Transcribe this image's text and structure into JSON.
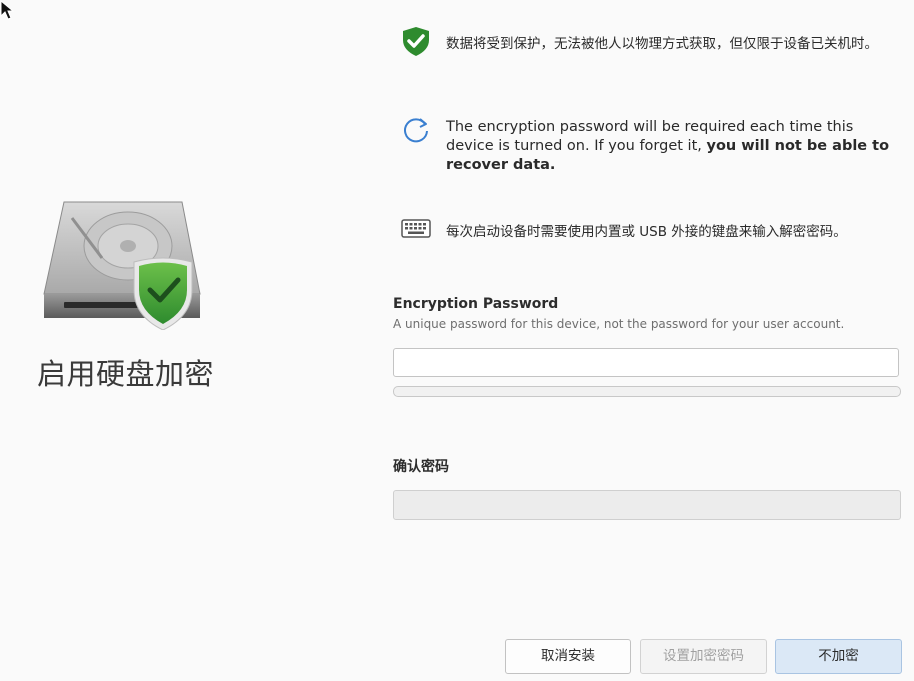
{
  "left": {
    "title": "启用硬盘加密"
  },
  "info": {
    "protect_text": "数据将受到保护，无法被他人以物理方式获取，但仅限于设备已关机时。",
    "password_text_plain": "The encryption password will be required each time this device is turned on. If you forget it, ",
    "password_text_bold": "you will not be able to recover data.",
    "keyboard_text": "每次启动设备时需要使用内置或 USB 外接的键盘来输入解密密码。"
  },
  "form": {
    "password_label": "Encryption Password",
    "password_hint": "A unique password for this device, not the password for your user account.",
    "password_value": "",
    "strength_level": 0,
    "confirm_label": "确认密码",
    "confirm_value": ""
  },
  "buttons": {
    "cancel": "取消安装",
    "set_password": "设置加密密码",
    "no_encrypt": "不加密"
  },
  "colors": {
    "shield_green": "#2e8b2e",
    "refresh_blue": "#3a7fd0",
    "primary_button": "#dbe8f6"
  },
  "icons": {
    "row1": "shield-check-icon",
    "row2": "refresh-icon",
    "row3": "keyboard-icon",
    "disk": "hard-drive-shield-icon"
  }
}
